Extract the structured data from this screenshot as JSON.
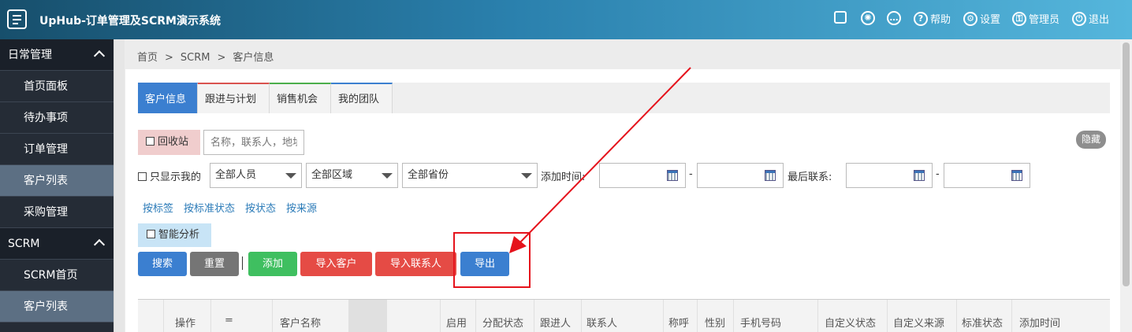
{
  "header": {
    "title": "UpHub-订单管理及SCRM演示系统",
    "help": "帮助",
    "settings": "设置",
    "user": "管理员",
    "logout": "退出"
  },
  "sidebar": {
    "groups": [
      {
        "title": "日常管理",
        "items": [
          "首页面板",
          "待办事项",
          "订单管理",
          "客户列表",
          "采购管理"
        ]
      },
      {
        "title": "SCRM",
        "items": [
          "SCRM首页",
          "客户列表"
        ]
      }
    ]
  },
  "breadcrumb": [
    "首页",
    ">",
    "SCRM",
    ">",
    "客户信息"
  ],
  "tabs": [
    "客户信息",
    "跟进与计划",
    "销售机会",
    "我的团队"
  ],
  "filters": {
    "recycle": "回收站",
    "search_placeholder": "名称，联系人，地址",
    "only_mine": "只显示我的",
    "person": "全部人员",
    "region": "全部区域",
    "province": "全部省份",
    "add_time": "添加时间:",
    "dash": "-",
    "last_contact": "最后联系:",
    "hide": "隐藏"
  },
  "quick_links": [
    "按标签",
    "按标准状态",
    "按状态",
    "按来源"
  ],
  "smart": "智能分析",
  "buttons": {
    "search": "搜索",
    "reset": "重置",
    "add": "添加",
    "import_customer": "导入客户",
    "import_contact": "导入联系人",
    "export": "导出",
    "separator": "|"
  },
  "table": {
    "columns": [
      "操作",
      "=",
      "客户名称",
      "启用",
      "分配状态",
      "跟进人",
      "联系人",
      "称呼",
      "性别",
      "手机号码",
      "自定义状态",
      "自定义来源",
      "标准状态",
      "添加时间"
    ]
  },
  "colors": {
    "primary": "#3b7fd0",
    "green": "#3fbf60",
    "red": "#e54b45",
    "gray": "#757575",
    "highlight": "#e5131c"
  }
}
